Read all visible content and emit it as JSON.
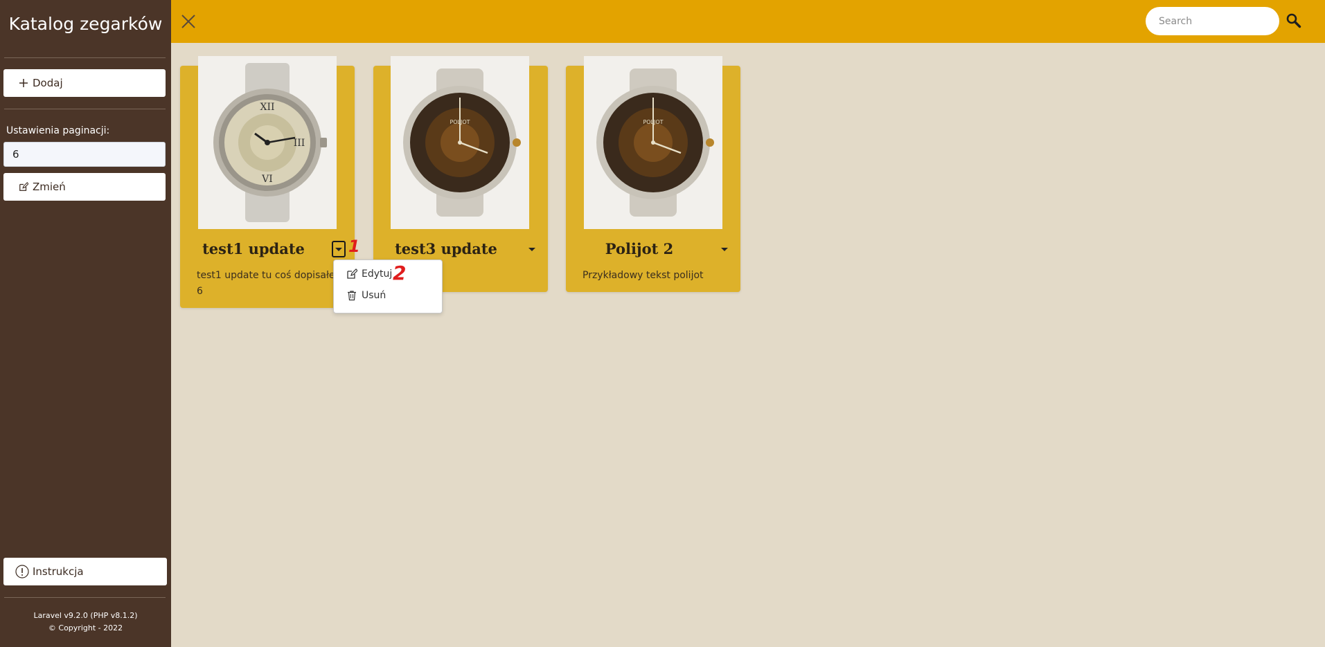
{
  "sidebar": {
    "brand": "Katalog zegarków",
    "add_label": "Dodaj",
    "pagination_label": "Ustawienia paginacji:",
    "pagination_value": "6",
    "change_label": "Zmień",
    "help_label": "Instrukcja",
    "footer_version": "Laravel v9.2.0 (PHP v8.1.2)",
    "footer_copyright": "© Copyright - 2022"
  },
  "topbar": {
    "search_placeholder": "Search",
    "close_icon": "close-icon",
    "search_icon": "search-icon"
  },
  "cards": [
    {
      "title": "test1 update",
      "desc_line1": "test1 update tu coś dopisałem",
      "desc_line2": "6",
      "image": "watch-photo-silver"
    },
    {
      "title": "test3 update",
      "desc_line1": "",
      "image": "watch-photo-poljot"
    },
    {
      "title": "Polijot 2",
      "desc_line1": "Przykładowy tekst polijot",
      "image": "watch-photo-poljot"
    }
  ],
  "dropdown": {
    "edit_label": "Edytuj",
    "delete_label": "Usuń"
  },
  "annotations": [
    "1",
    "2"
  ],
  "colors": {
    "sidebar": "#4b3528",
    "topbar": "#e3a300",
    "card": "#ddb12a",
    "background": "#e3dac8",
    "annotation": "#e01d1d"
  }
}
